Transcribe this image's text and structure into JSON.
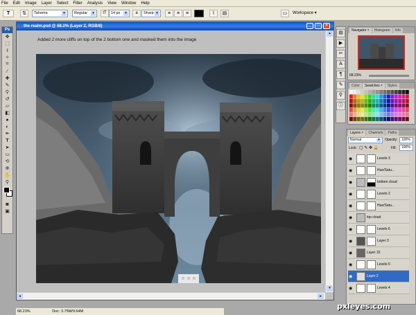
{
  "menu": [
    "File",
    "Edit",
    "Image",
    "Layer",
    "Select",
    "Filter",
    "Analysis",
    "View",
    "Window",
    "Help"
  ],
  "options": {
    "tool_glyph": "T",
    "font_family": "Tahoma",
    "font_style": "Regular",
    "font_size": "14 px",
    "antialias_label": "a",
    "antialias": "Sharp",
    "workspace": "Workspace ▾"
  },
  "document": {
    "title": "the realm.psd @ 68.2% (Layer 2, RGB/8)",
    "annotation": "Added 2 more cliffs on top of the 2 bottom one and masked them into the image"
  },
  "status": {
    "zoom": "68.23%",
    "doc": "Doc: 3.75M/9.64M"
  },
  "navigator": {
    "tabs": [
      "Navigator ×",
      "Histogram",
      "Info"
    ],
    "zoom": "68.23%"
  },
  "swatches": {
    "tabs": [
      "Color",
      "Swatches ×",
      "Styles"
    ]
  },
  "layers": {
    "tabs": [
      "Layers ×",
      "Channels",
      "Paths"
    ],
    "blend_mode": "Normal",
    "opacity_label": "Opacity:",
    "opacity": "100%",
    "lock_label": "Lock:",
    "fill_label": "Fill:",
    "fill": "100%",
    "items": [
      {
        "name": "Levels 3"
      },
      {
        "name": "Hue/Satu..."
      },
      {
        "name": "bottom cloud"
      },
      {
        "name": "Levels 2"
      },
      {
        "name": "Hue/Satu..."
      },
      {
        "name": "top cloud"
      },
      {
        "name": "Levels 6"
      },
      {
        "name": "Layer 3"
      },
      {
        "name": "Layer 15"
      },
      {
        "name": "Levels 5"
      },
      {
        "name": "Layer 2",
        "selected": true
      },
      {
        "name": "Levels 4"
      }
    ]
  },
  "watermark": "pxleyes.com"
}
